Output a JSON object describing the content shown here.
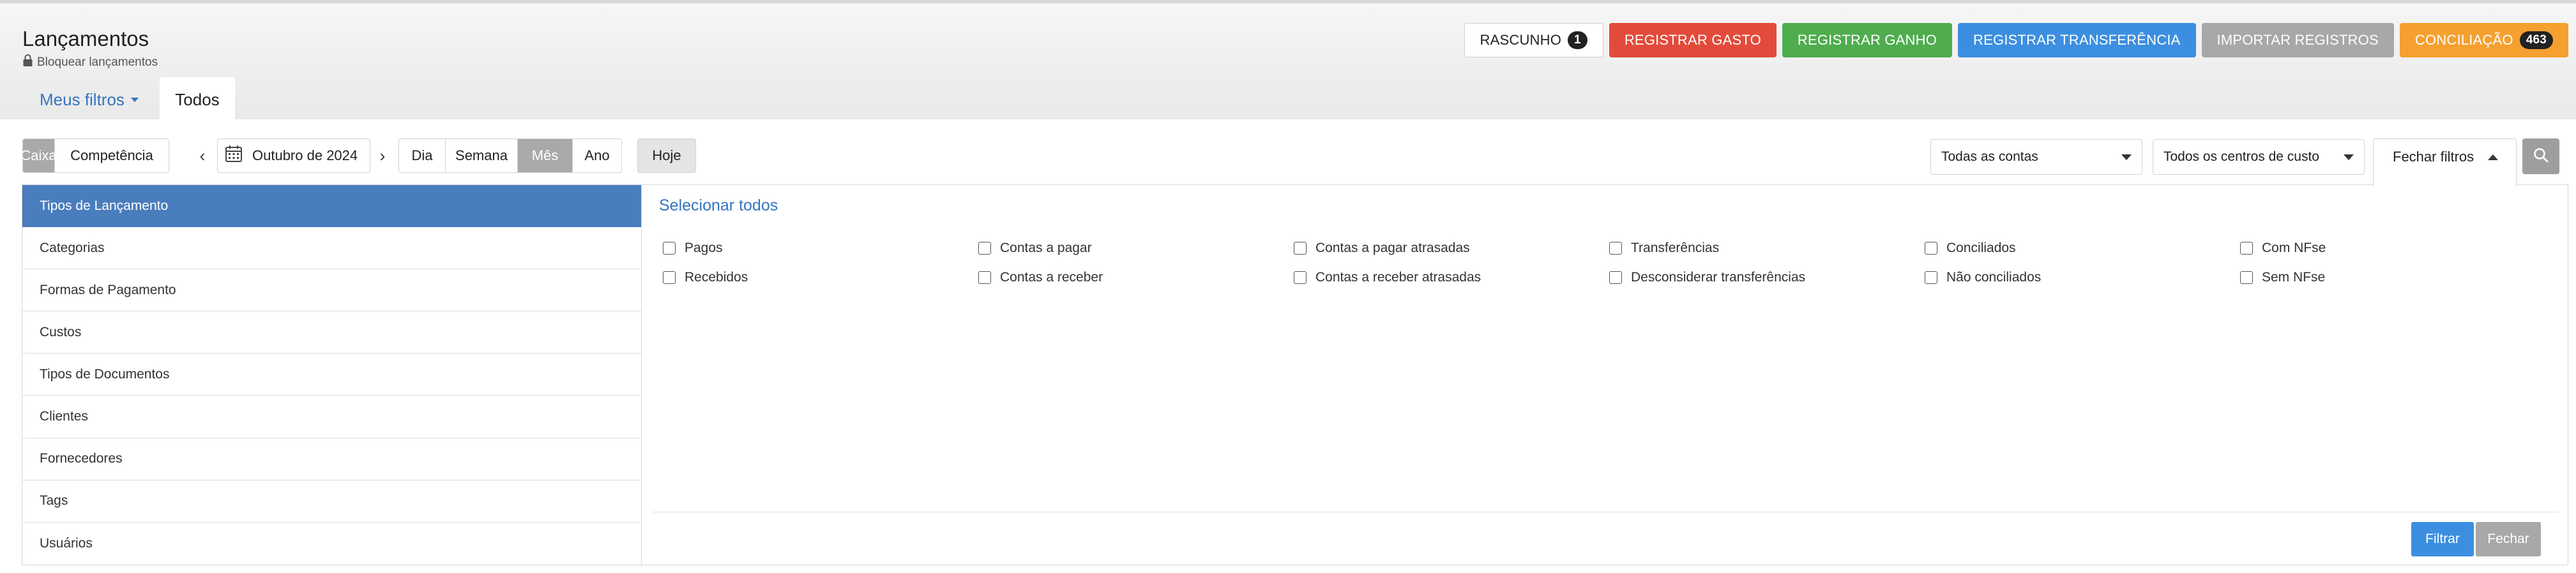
{
  "header": {
    "title": "Lançamentos",
    "lock_label": "Bloquear lançamentos"
  },
  "actions": {
    "draft": {
      "label": "RASCUNHO",
      "count": "1"
    },
    "expense": "REGISTRAR GASTO",
    "income": "REGISTRAR GANHO",
    "transfer": "REGISTRAR TRANSFERÊNCIA",
    "import": "IMPORTAR REGISTROS",
    "reconciliation": {
      "label": "CONCILIAÇÃO",
      "count": "463"
    }
  },
  "tabs": {
    "my_filters": "Meus filtros",
    "all": "Todos"
  },
  "toolbar": {
    "regime": [
      "Caixa",
      "Competência"
    ],
    "regime_selected": "Caixa",
    "date": "Outubro de 2024",
    "periods": [
      "Dia",
      "Semana",
      "Mês",
      "Ano"
    ],
    "period_selected": "Mês",
    "today": "Hoje",
    "accounts_select": "Todas as contas",
    "cost_centers_select": "Todos os centros de custo",
    "close_filters": "Fechar filtros"
  },
  "filter_panel": {
    "categories": [
      "Tipos de Lançamento",
      "Categorias",
      "Formas de Pagamento",
      "Custos",
      "Tipos de Documentos",
      "Clientes",
      "Fornecedores",
      "Tags",
      "Usuários"
    ],
    "active_category": "Tipos de Lançamento",
    "select_all": "Selecionar todos",
    "options": [
      "Pagos",
      "Contas a pagar",
      "Contas a pagar atrasadas",
      "Transferências",
      "Conciliados",
      "Com NFse",
      "Recebidos",
      "Contas a receber",
      "Contas a receber atrasadas",
      "Desconsiderar transferências",
      "Não conciliados",
      "Sem NFse"
    ],
    "filter_button": "Filtrar",
    "close_button": "Fechar"
  },
  "colors": {
    "primary": "#3c8fe0",
    "danger": "#e24b3b",
    "success": "#4fad4e",
    "warning": "#f5a030",
    "muted": "#a8a8a8",
    "active_category": "#4a7dbd"
  }
}
